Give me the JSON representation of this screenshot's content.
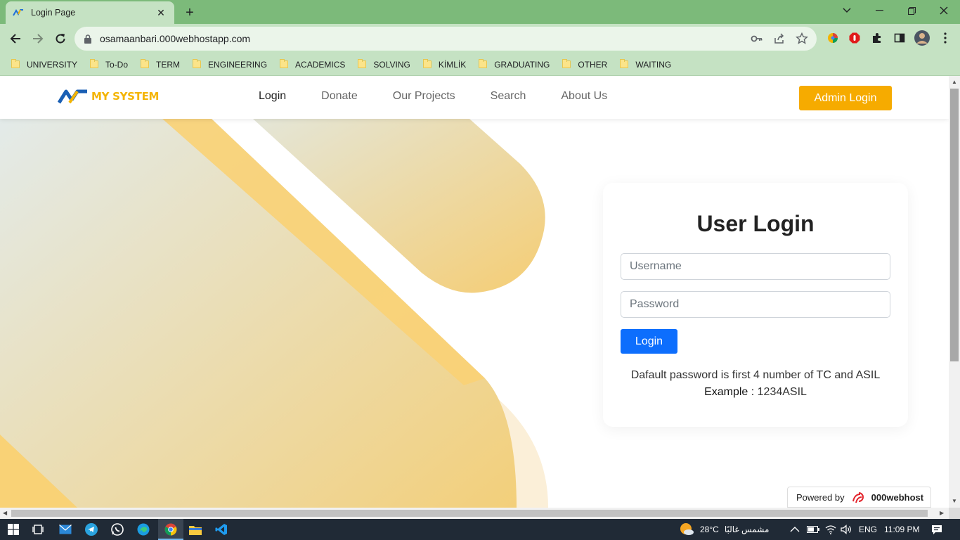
{
  "browser": {
    "tab_title": "Login Page",
    "url": "osamaanbari.000webhostapp.com",
    "bookmarks": [
      "UNIVERSITY",
      "To-Do",
      "TERM",
      "ENGINEERING",
      "ACADEMICS",
      "SOLVING",
      "KİMLİK",
      "GRADUATING",
      "OTHER",
      "WAITING"
    ]
  },
  "site": {
    "logo_text": "MY SYSTEM",
    "nav": [
      "Login",
      "Donate",
      "Our Projects",
      "Search",
      "About Us"
    ],
    "admin_button": "Admin Login"
  },
  "login": {
    "title": "User Login",
    "username_placeholder": "Username",
    "password_placeholder": "Password",
    "button": "Login",
    "note": "Dafault password is first 4 number of TC and ASIL",
    "example_label": "Example :",
    "example_value": "1234ASIL"
  },
  "footer": {
    "powered_by": "Powered by",
    "brand": "000webhost"
  },
  "taskbar": {
    "weather_temp": "28°C",
    "weather_text": "مشمس غالبًا",
    "language": "ENG",
    "time": "11:09 PM"
  },
  "colors": {
    "tabstrip": "#7cba7a",
    "toolbar": "#c5e2c3",
    "accent": "#f6ab00",
    "primary": "#0d6efd"
  }
}
